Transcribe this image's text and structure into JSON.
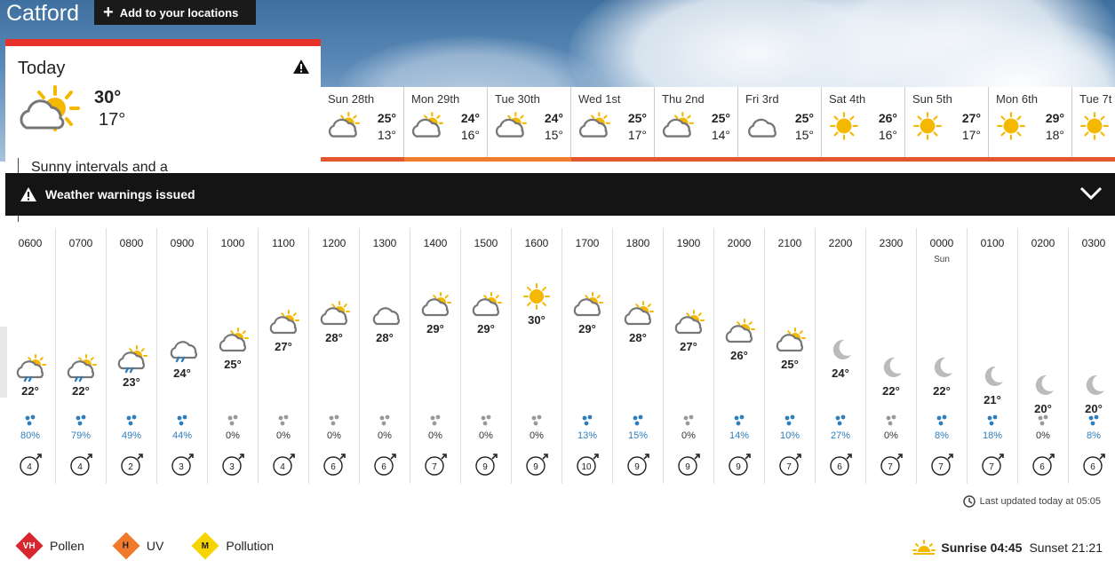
{
  "location": {
    "name": "Catford",
    "add_label": "Add to your locations"
  },
  "today": {
    "title": "Today",
    "max": "30°",
    "min": "17°",
    "description": "Sunny intervals and a",
    "icon": "sunny-intervals-icon"
  },
  "forecast": [
    {
      "day": "Sun",
      "date": "28th",
      "max": "25°",
      "min": "13°",
      "icon": "sunny-intervals",
      "bar": "#e4572e"
    },
    {
      "day": "Mon",
      "date": "29th",
      "max": "24°",
      "min": "16°",
      "icon": "sunny-intervals",
      "bar": "#ef7d2d"
    },
    {
      "day": "Tue",
      "date": "30th",
      "max": "24°",
      "min": "15°",
      "icon": "sunny-intervals",
      "bar": "#ef7d2d"
    },
    {
      "day": "Wed",
      "date": "1st",
      "max": "25°",
      "min": "17°",
      "icon": "sunny-intervals",
      "bar": "#e4572e"
    },
    {
      "day": "Thu",
      "date": "2nd",
      "max": "25°",
      "min": "14°",
      "icon": "sunny-intervals",
      "bar": "#e4572e"
    },
    {
      "day": "Fri",
      "date": "3rd",
      "max": "25°",
      "min": "15°",
      "icon": "cloud",
      "bar": "#e4572e"
    },
    {
      "day": "Sat",
      "date": "4th",
      "max": "26°",
      "min": "16°",
      "icon": "sun",
      "bar": "#e4572e"
    },
    {
      "day": "Sun",
      "date": "5th",
      "max": "27°",
      "min": "17°",
      "icon": "sun",
      "bar": "#e4572e"
    },
    {
      "day": "Mon",
      "date": "6th",
      "max": "29°",
      "min": "18°",
      "icon": "sun",
      "bar": "#e4572e"
    },
    {
      "day": "Tue",
      "date": "7t",
      "max": "",
      "min": "",
      "icon": "sun",
      "bar": "#e4572e"
    }
  ],
  "warning": {
    "label": "Weather warnings issued"
  },
  "hours": [
    {
      "time": "0600",
      "temp": "22°",
      "icon": "light-rain-sun",
      "rain": "80%",
      "wind": "4",
      "raincolor": "#2e7dbd",
      "dropcolor": "#2e7dbd"
    },
    {
      "time": "0700",
      "temp": "22°",
      "icon": "light-rain-sun",
      "rain": "79%",
      "wind": "4",
      "raincolor": "#2e7dbd",
      "dropcolor": "#2e7dbd"
    },
    {
      "time": "0800",
      "temp": "23°",
      "icon": "light-rain-sun",
      "rain": "49%",
      "wind": "2",
      "raincolor": "#2e7dbd",
      "dropcolor": "#2e7dbd"
    },
    {
      "time": "0900",
      "temp": "24°",
      "icon": "light-rain",
      "rain": "44%",
      "wind": "3",
      "raincolor": "#2e7dbd",
      "dropcolor": "#2e7dbd"
    },
    {
      "time": "1000",
      "temp": "25°",
      "icon": "sunny-intervals",
      "rain": "0%",
      "wind": "3",
      "raincolor": "#333",
      "dropcolor": "#999"
    },
    {
      "time": "1100",
      "temp": "27°",
      "icon": "sunny-intervals",
      "rain": "0%",
      "wind": "4",
      "raincolor": "#333",
      "dropcolor": "#999"
    },
    {
      "time": "1200",
      "temp": "28°",
      "icon": "sunny-intervals",
      "rain": "0%",
      "wind": "6",
      "raincolor": "#333",
      "dropcolor": "#999"
    },
    {
      "time": "1300",
      "temp": "28°",
      "icon": "cloud",
      "rain": "0%",
      "wind": "6",
      "raincolor": "#333",
      "dropcolor": "#999"
    },
    {
      "time": "1400",
      "temp": "29°",
      "icon": "sunny-intervals",
      "rain": "0%",
      "wind": "7",
      "raincolor": "#333",
      "dropcolor": "#999"
    },
    {
      "time": "1500",
      "temp": "29°",
      "icon": "sunny-intervals",
      "rain": "0%",
      "wind": "9",
      "raincolor": "#333",
      "dropcolor": "#999"
    },
    {
      "time": "1600",
      "temp": "30°",
      "icon": "sun",
      "rain": "0%",
      "wind": "9",
      "raincolor": "#333",
      "dropcolor": "#999"
    },
    {
      "time": "1700",
      "temp": "29°",
      "icon": "sunny-intervals",
      "rain": "13%",
      "wind": "10",
      "raincolor": "#2e7dbd",
      "dropcolor": "#2e7dbd"
    },
    {
      "time": "1800",
      "temp": "28°",
      "icon": "sunny-intervals",
      "rain": "15%",
      "wind": "9",
      "raincolor": "#2e7dbd",
      "dropcolor": "#2e7dbd"
    },
    {
      "time": "1900",
      "temp": "27°",
      "icon": "sunny-intervals",
      "rain": "0%",
      "wind": "9",
      "raincolor": "#333",
      "dropcolor": "#999"
    },
    {
      "time": "2000",
      "temp": "26°",
      "icon": "sunny-intervals",
      "rain": "14%",
      "wind": "9",
      "raincolor": "#2e7dbd",
      "dropcolor": "#2e7dbd"
    },
    {
      "time": "2100",
      "temp": "25°",
      "icon": "sunny-intervals",
      "rain": "10%",
      "wind": "7",
      "raincolor": "#2e7dbd",
      "dropcolor": "#2e7dbd"
    },
    {
      "time": "2200",
      "temp": "24°",
      "icon": "moon",
      "rain": "27%",
      "wind": "6",
      "raincolor": "#2e7dbd",
      "dropcolor": "#2e7dbd"
    },
    {
      "time": "2300",
      "temp": "22°",
      "icon": "moon",
      "rain": "0%",
      "wind": "7",
      "raincolor": "#333",
      "dropcolor": "#999"
    },
    {
      "time": "0000",
      "sub": "Sun",
      "temp": "22°",
      "icon": "moon",
      "rain": "8%",
      "wind": "7",
      "raincolor": "#2e7dbd",
      "dropcolor": "#2e7dbd"
    },
    {
      "time": "0100",
      "temp": "21°",
      "icon": "moon",
      "rain": "18%",
      "wind": "7",
      "raincolor": "#2e7dbd",
      "dropcolor": "#2e7dbd"
    },
    {
      "time": "0200",
      "temp": "20°",
      "icon": "moon",
      "rain": "0%",
      "wind": "6",
      "raincolor": "#333",
      "dropcolor": "#999"
    },
    {
      "time": "0300",
      "temp": "20°",
      "icon": "moon",
      "rain": "8%",
      "wind": "6",
      "raincolor": "#2e7dbd",
      "dropcolor": "#2e7dbd"
    }
  ],
  "last_updated": "Last updated today at 05:05",
  "indices": [
    {
      "code": "VH",
      "label": "Pollen",
      "color": "#d7262d",
      "textcolor": "#fff"
    },
    {
      "code": "H",
      "label": "UV",
      "color": "#f0792b",
      "textcolor": "#222"
    },
    {
      "code": "M",
      "label": "Pollution",
      "color": "#f5d400",
      "textcolor": "#222"
    }
  ],
  "sun": {
    "sunrise_label": "Sunrise",
    "sunrise": "04:45",
    "sunset_label": "Sunset",
    "sunset": "21:21"
  }
}
